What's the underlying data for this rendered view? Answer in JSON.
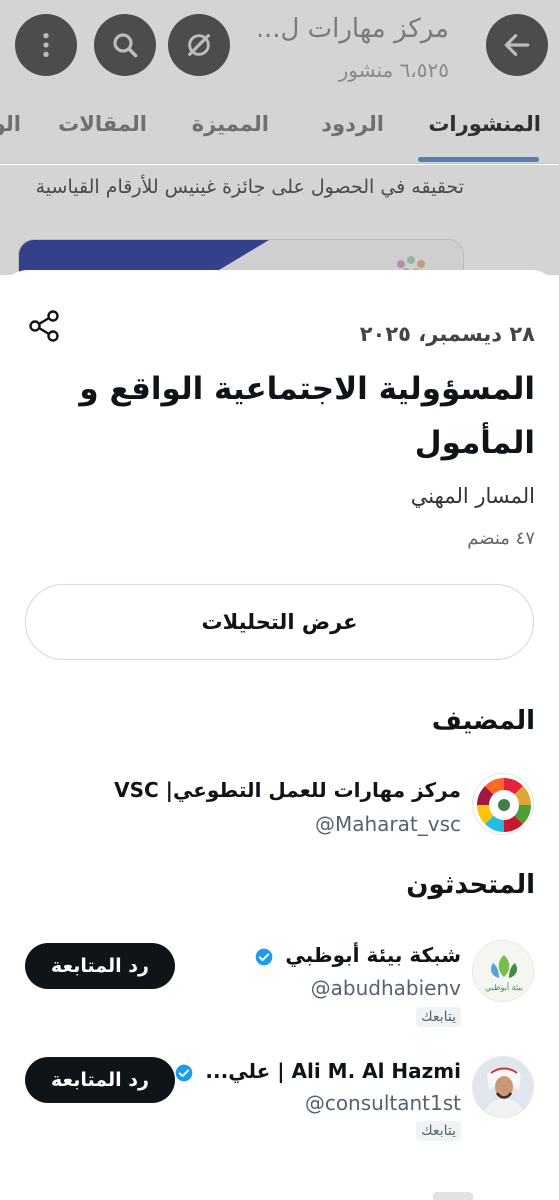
{
  "header": {
    "title": "مركز مهارات ل...",
    "post_count": "٦،٥٢٥ منشور"
  },
  "icons": {
    "back": "arrow-left-icon",
    "grok": "grok-icon",
    "search": "search-icon",
    "more": "more-vertical-icon",
    "share": "share-icon",
    "verified": "verified-badge-icon"
  },
  "tabs": [
    {
      "label": "المنشورات",
      "active": true
    },
    {
      "label": "الردود"
    },
    {
      "label": "المميزة"
    },
    {
      "label": "المقالات"
    },
    {
      "label": "الو"
    }
  ],
  "feed_snippet": {
    "text": "تحقيقه في الحصول على جائزة غينيس للأرقام القياسية"
  },
  "space": {
    "date": "٢٨ ديسمبر، ٢٠٢٥",
    "title": "المسؤولية الاجتماعية الواقع و المأمول",
    "category": "المسار المهني",
    "joined": "٤٧ منضم",
    "analytics_button": "عرض التحليلات"
  },
  "host_section": {
    "heading": "المضيف",
    "name": "مركز مهارات للعمل التطوعي| VSC",
    "handle": "@Maharat_vsc"
  },
  "speakers_section": {
    "heading": "المتحدثون",
    "speakers": [
      {
        "name": "شبكة بيئة أبوظبي",
        "handle": "@abudhabienv",
        "follows_you": "يتابعك",
        "button": "رد المتابعة",
        "avatar_text": "بيئة أبوظبي"
      },
      {
        "name": "Ali M. Al Hazmi | علي...",
        "handle": "@consultant1st",
        "follows_you": "يتابعك",
        "button": "رد المتابعة"
      }
    ]
  },
  "colors": {
    "accent": "#4f7fb0",
    "verified": "#1d9bf0",
    "button_dark": "#0f1419"
  }
}
